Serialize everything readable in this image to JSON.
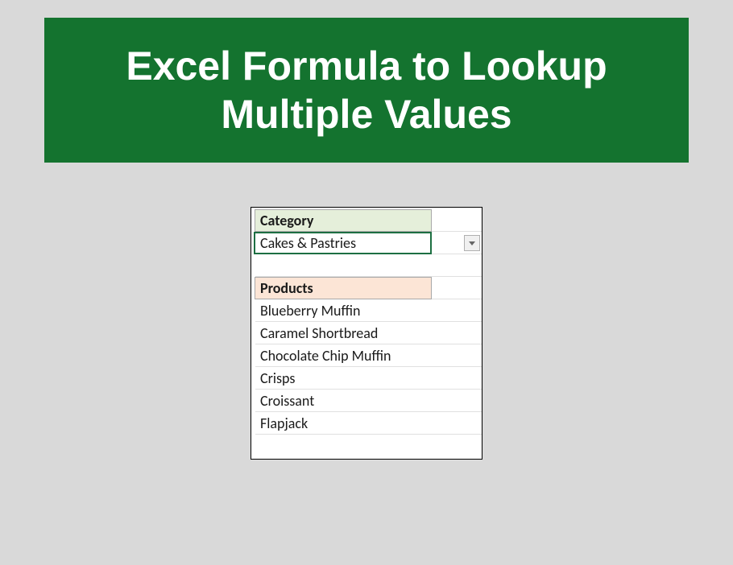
{
  "title": "Excel Formula to Lookup Multiple Values",
  "category": {
    "header": "Category",
    "selected": "Cakes & Pastries"
  },
  "products": {
    "header": "Products",
    "items": [
      "Blueberry Muffin",
      "Caramel Shortbread",
      "Chocolate Chip Muffin",
      "Crisps",
      "Croissant",
      "Flapjack"
    ]
  }
}
